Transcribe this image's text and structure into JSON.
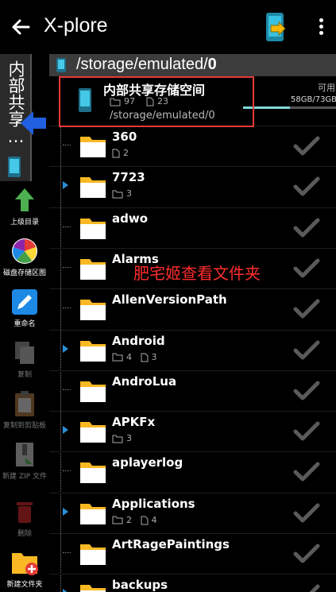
{
  "appbar": {
    "title": "X-plore"
  },
  "path": {
    "prefix": "/storage/emulated/",
    "last": "0"
  },
  "left_tab": {
    "label": "内部共享…"
  },
  "tools": [
    {
      "label": "上级目录",
      "enabled": true
    },
    {
      "label": "磁盘存储区图",
      "enabled": true
    },
    {
      "label": "重命名",
      "enabled": true
    },
    {
      "label": "复制",
      "enabled": false
    },
    {
      "label": "复制到剪贴板",
      "enabled": false
    },
    {
      "label": "新建 ZIP 文件",
      "enabled": false
    },
    {
      "label": "删除",
      "enabled": false
    },
    {
      "label": "新建文件夹",
      "enabled": true
    }
  ],
  "storage": {
    "title": "内部共享存储空间",
    "folders": "97",
    "files": "23",
    "path": "/storage/emulated/0",
    "available_label": "可用",
    "capacity": "58GB/73GB",
    "used_fraction": 0.5
  },
  "annotation": "肥宅姬查看文件夹",
  "folders": [
    {
      "name": "360",
      "expandable": false,
      "folders": "",
      "files": "2"
    },
    {
      "name": "7723",
      "expandable": true,
      "folders": "3",
      "files": ""
    },
    {
      "name": "adwo",
      "expandable": false,
      "folders": "",
      "files": ""
    },
    {
      "name": "Alarms",
      "expandable": false,
      "folders": "",
      "files": ""
    },
    {
      "name": "AllenVersionPath",
      "expandable": false,
      "folders": "",
      "files": ""
    },
    {
      "name": "Android",
      "expandable": true,
      "folders": "4",
      "files": "3"
    },
    {
      "name": "AndroLua",
      "expandable": false,
      "folders": "",
      "files": ""
    },
    {
      "name": "APKFx",
      "expandable": true,
      "folders": "3",
      "files": ""
    },
    {
      "name": "aplayerlog",
      "expandable": false,
      "folders": "",
      "files": ""
    },
    {
      "name": "Applications",
      "expandable": true,
      "folders": "2",
      "files": "4"
    },
    {
      "name": "ArtRagePaintings",
      "expandable": false,
      "folders": "",
      "files": ""
    },
    {
      "name": "backups",
      "expandable": true,
      "folders": "",
      "files": ""
    }
  ]
}
